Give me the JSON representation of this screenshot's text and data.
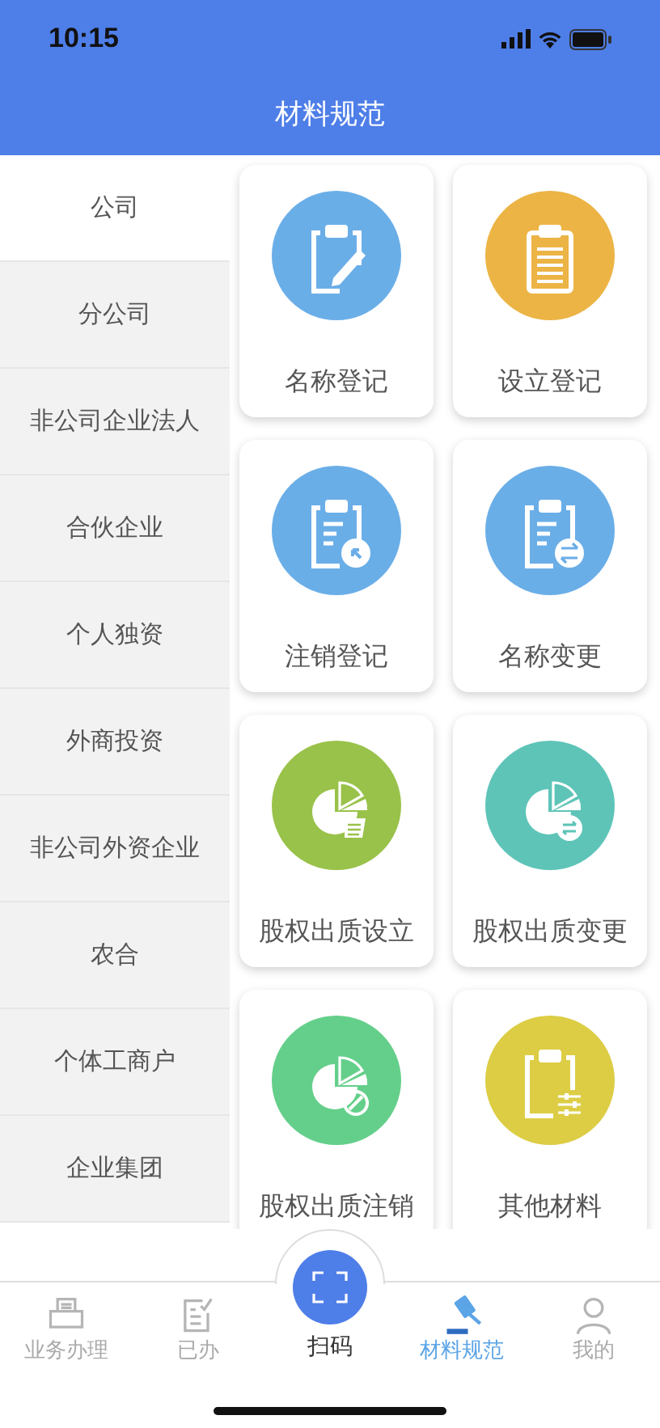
{
  "status_bar": {
    "time": "10:15"
  },
  "header": {
    "title": "材料规范"
  },
  "sidebar": {
    "items": [
      {
        "label": "公司",
        "selected": true
      },
      {
        "label": "分公司",
        "selected": false
      },
      {
        "label": "非公司企业法人",
        "selected": false
      },
      {
        "label": "合伙企业",
        "selected": false
      },
      {
        "label": "个人独资",
        "selected": false
      },
      {
        "label": "外商投资",
        "selected": false
      },
      {
        "label": "非公司外资企业",
        "selected": false
      },
      {
        "label": "农合",
        "selected": false
      },
      {
        "label": "个体工商户",
        "selected": false
      },
      {
        "label": "企业集团",
        "selected": false
      }
    ]
  },
  "cards": [
    {
      "label": "名称登记",
      "kind": "clipboard-pen",
      "color": "#6aaee8"
    },
    {
      "label": "设立登记",
      "kind": "clipboard-lines",
      "color": "#ecb445"
    },
    {
      "label": "注销登记",
      "kind": "clipboard-return",
      "color": "#6aaee8"
    },
    {
      "label": "名称变更",
      "kind": "clipboard-swap",
      "color": "#6aaee8"
    },
    {
      "label": "股权出质设立",
      "kind": "pie-doc",
      "color": "#99c24a"
    },
    {
      "label": "股权出质变更",
      "kind": "pie-swap",
      "color": "#5ec4b8"
    },
    {
      "label": "股权出质注销",
      "kind": "pie-ban",
      "color": "#64cf8a"
    },
    {
      "label": "其他材料",
      "kind": "clipboard-sliders",
      "color": "#dccd45"
    }
  ],
  "tab_bar": {
    "items": [
      {
        "label": "业务办理",
        "kind": "printer",
        "selected": false
      },
      {
        "label": "已办",
        "kind": "checklist",
        "selected": false
      },
      {
        "label": "扫码",
        "kind": "scan",
        "selected": false
      },
      {
        "label": "材料规范",
        "kind": "gavel",
        "selected": true
      },
      {
        "label": "我的",
        "kind": "person",
        "selected": false
      }
    ]
  }
}
